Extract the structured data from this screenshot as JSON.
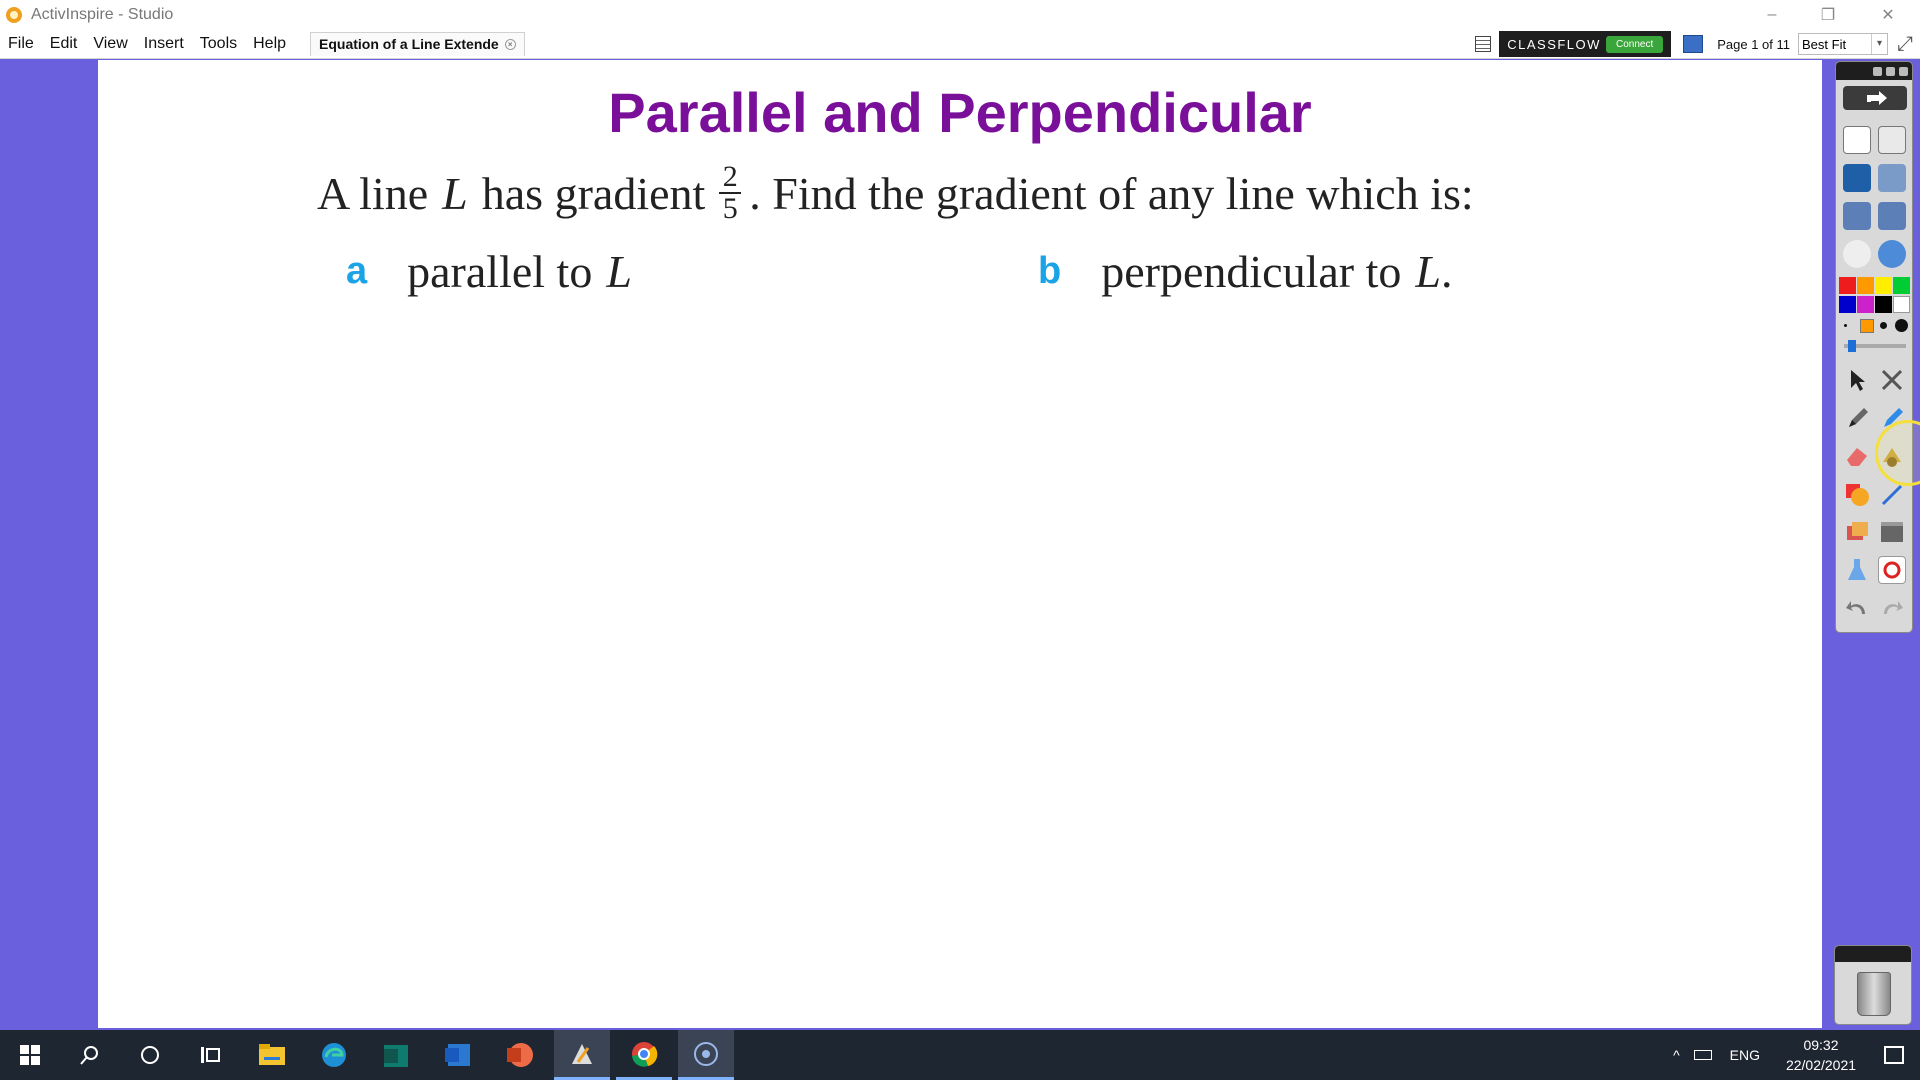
{
  "window": {
    "title": "ActivInspire - Studio",
    "minimize_glyph": "–",
    "maximize_glyph": "❐",
    "close_glyph": "✕"
  },
  "menu": {
    "items": [
      "File",
      "Edit",
      "View",
      "Insert",
      "Tools",
      "Help"
    ],
    "document_tab": "Equation of a Line Extende",
    "tab_close_glyph": "×",
    "classflow_label": "CLASSFLOW",
    "connect_label": "Connect",
    "page_indicator": "Page 1 of 11",
    "zoom_value": "Best Fit",
    "zoom_arrow_glyph": "▾",
    "fullscreen_glyph": "⤢"
  },
  "slide": {
    "title": "Parallel and Perpendicular",
    "question_prefix": "A line",
    "line_symbol": "L",
    "question_middle": "has gradient",
    "gradient_numerator": "2",
    "gradient_denominator": "5",
    "question_suffix": ". Find the gradient of any line which is:",
    "part_a_letter": "a",
    "part_a_text": "parallel to",
    "part_a_symbol": "L",
    "part_b_letter": "b",
    "part_b_text": "perpendicular to",
    "part_b_symbol": "L",
    "part_b_end": "."
  },
  "toolbox": {
    "swatches": [
      "#ee1c1c",
      "#ff9900",
      "#ffee00",
      "#00cc33",
      "#0000cc",
      "#cc22cc",
      "#000000",
      "#ffffff"
    ],
    "icons": [
      "share-icon",
      "flipchart-browser-icon",
      "resource-library-icon",
      "handwriting-icon",
      "tools-icon",
      "previous-page-icon",
      "next-page-icon",
      "play-icon",
      "web-browser-icon",
      "select-icon",
      "magic-ink-icon",
      "pen-icon",
      "highlighter-icon",
      "eraser-icon",
      "fill-icon",
      "shape-icon",
      "connector-icon",
      "clear-icon",
      "reset-icon",
      "undo-icon",
      "redo-icon"
    ]
  },
  "taskbar": {
    "apps": [
      "start-icon",
      "search-icon",
      "cortana-icon",
      "task-view-icon",
      "file-explorer-icon",
      "edge-icon",
      "publisher-icon",
      "word-icon",
      "powerpoint-icon",
      "activinspire-icon",
      "chrome-icon",
      "recorder-icon"
    ],
    "tray_chevron": "^",
    "language": "ENG",
    "time": "09:32",
    "date": "22/02/2021"
  }
}
